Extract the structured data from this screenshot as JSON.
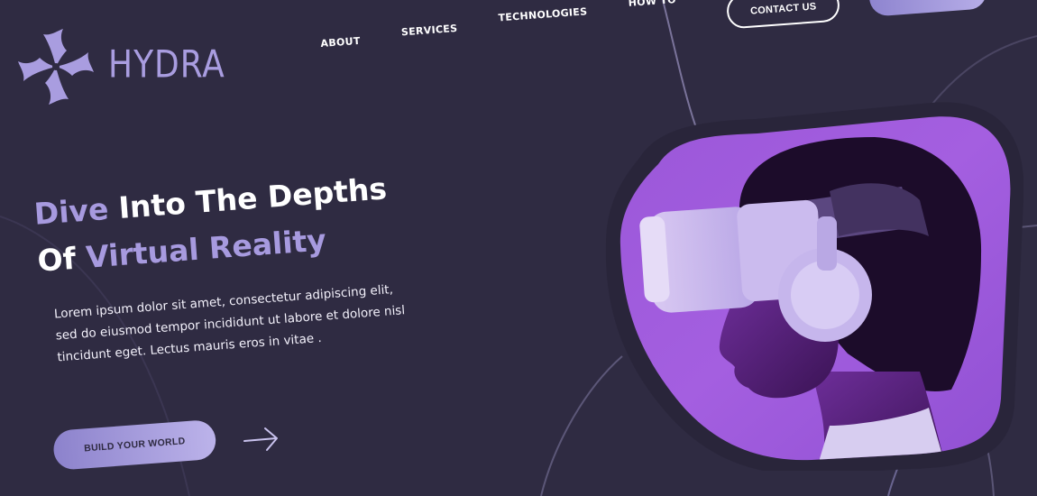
{
  "brand": {
    "name": "HYDRA",
    "accent": "#a99de0",
    "background": "#2f2b42"
  },
  "nav": {
    "items": [
      {
        "label": "ABOUT"
      },
      {
        "label": "SERVICES"
      },
      {
        "label": "TECHNOLOGIES"
      },
      {
        "label": "HOW TO"
      }
    ],
    "contact_label": "CONTACT US"
  },
  "hero": {
    "headline_part1": "Dive",
    "headline_part2": " Into The Depths",
    "headline_part3": "Of ",
    "headline_part4": "Virtual Reality",
    "description": "Lorem ipsum dolor sit amet, consectetur adipiscing elit, sed do eiusmod tempor incididunt ut labore et dolore nisl tincidunt eget. Lectus mauris eros in vitae .",
    "cta_label": "BUILD YOUR WORLD"
  },
  "icons": {
    "logo": "hydra-swirl-icon",
    "cta_arrow": "arrow-right-icon",
    "hero_image": "vr-headset-person-image"
  }
}
